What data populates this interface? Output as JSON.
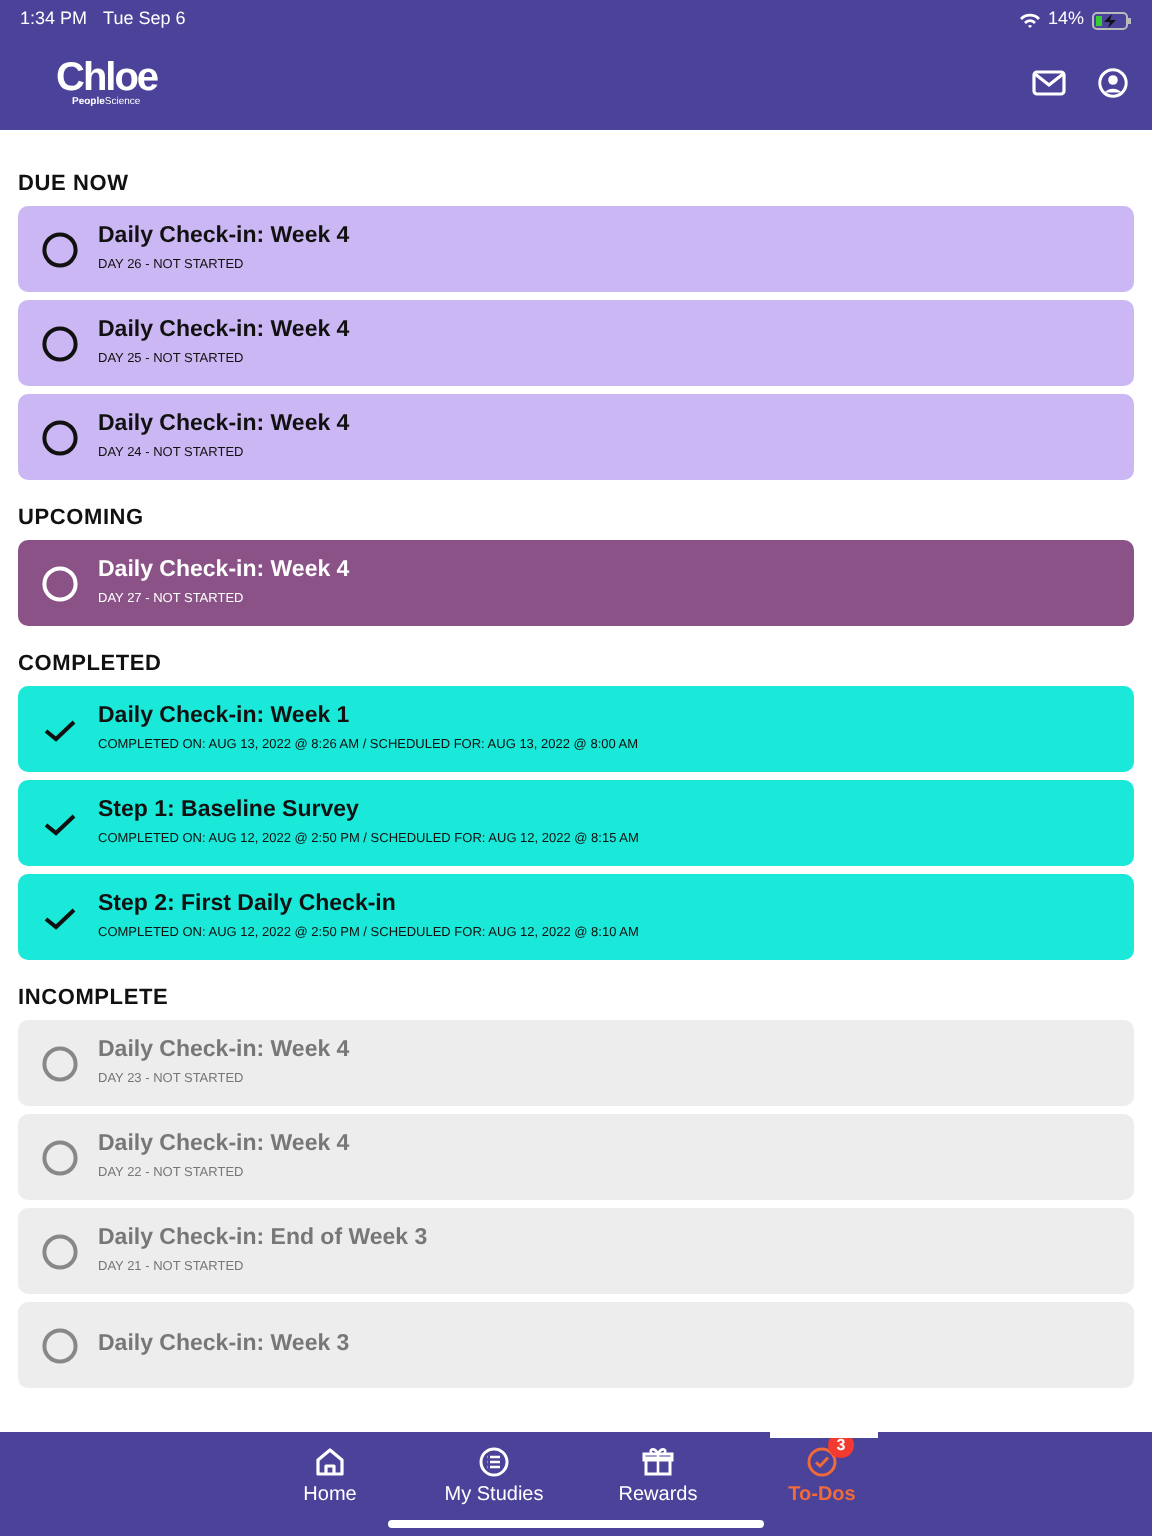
{
  "status_bar": {
    "time": "1:34 PM",
    "date": "Tue Sep 6",
    "battery": "14%"
  },
  "header": {
    "logo": "Chloe",
    "logo_subtitle_bold": "People",
    "logo_subtitle": "Science"
  },
  "sections": [
    {
      "title": "DUE NOW",
      "kind": "due",
      "tasks": [
        {
          "title": "Daily Check-in: Week 4",
          "detail": "DAY 26 - NOT STARTED",
          "done": false
        },
        {
          "title": "Daily Check-in: Week 4",
          "detail": "DAY 25 - NOT STARTED",
          "done": false
        },
        {
          "title": "Daily Check-in: Week 4",
          "detail": "DAY 24 - NOT STARTED",
          "done": false
        }
      ]
    },
    {
      "title": "UPCOMING",
      "kind": "upcoming",
      "tasks": [
        {
          "title": "Daily Check-in: Week 4",
          "detail": "DAY 27 - NOT STARTED",
          "done": false
        }
      ]
    },
    {
      "title": "COMPLETED",
      "kind": "completed",
      "tasks": [
        {
          "title": "Daily Check-in: Week 1",
          "detail": "COMPLETED ON: AUG 13, 2022 @ 8:26 AM / SCHEDULED FOR: AUG 13, 2022 @ 8:00 AM",
          "done": true
        },
        {
          "title": "Step 1: Baseline Survey",
          "detail": "COMPLETED ON: AUG 12, 2022 @ 2:50 PM / SCHEDULED FOR: AUG 12, 2022 @ 8:15 AM",
          "done": true
        },
        {
          "title": "Step 2: First Daily Check-in",
          "detail": "COMPLETED ON: AUG 12, 2022 @ 2:50 PM / SCHEDULED FOR: AUG 12, 2022 @ 8:10 AM",
          "done": true
        }
      ]
    },
    {
      "title": "INCOMPLETE",
      "kind": "incomplete",
      "tasks": [
        {
          "title": "Daily Check-in: Week 4",
          "detail": "DAY 23 - NOT STARTED",
          "done": false
        },
        {
          "title": "Daily Check-in: Week 4",
          "detail": "DAY 22 - NOT STARTED",
          "done": false
        },
        {
          "title": "Daily Check-in: End of Week 3",
          "detail": "DAY 21 - NOT STARTED",
          "done": false
        },
        {
          "title": "Daily Check-in: Week 3",
          "done": false
        }
      ]
    }
  ],
  "tab_bar": [
    {
      "label": "Home",
      "kind": "home",
      "selected": false
    },
    {
      "label": "My Studies",
      "kind": "studies",
      "selected": false
    },
    {
      "label": "Rewards",
      "kind": "rewards",
      "selected": false
    },
    {
      "label": "To-Dos",
      "kind": "todos",
      "selected": true,
      "badge": "3"
    }
  ]
}
